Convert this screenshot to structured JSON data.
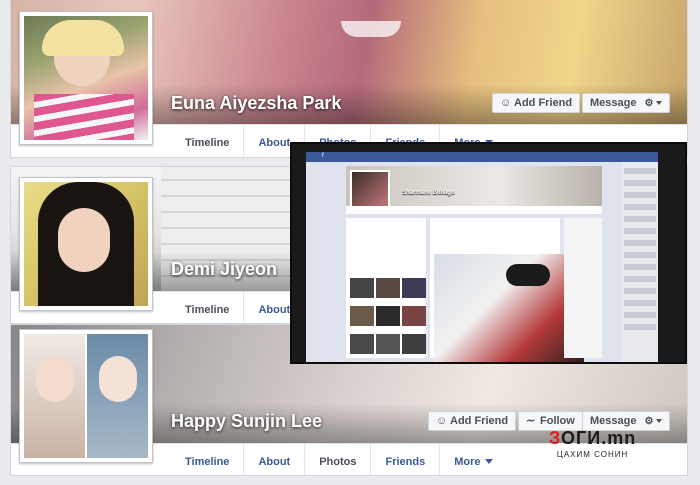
{
  "profiles": [
    {
      "name": "Euna Aiyezsha Park",
      "tabs": [
        "Timeline",
        "About",
        "Photos",
        "Friends",
        "More"
      ],
      "buttons": {
        "add_friend": "Add Friend",
        "message": "Message"
      }
    },
    {
      "name": "Demi Jiyeon",
      "tabs": [
        "Timeline",
        "About"
      ]
    },
    {
      "name": "Happy Sunjin Lee",
      "tabs": [
        "Timeline",
        "About",
        "Photos",
        "Friends",
        "More"
      ],
      "buttons": {
        "add_friend": "Add Friend",
        "follow": "Follow",
        "message": "Message"
      }
    }
  ],
  "screenshot": {
    "profile_name": "Sharmane Biolago"
  },
  "watermark": {
    "title_red": "З",
    "title_rest": "ОГИ.mn",
    "subtitle": "ЦАХИМ СОНИН"
  },
  "icons": {
    "add_friend": "add-friend-icon",
    "follow": "rss-follow-icon",
    "gear": "gear-icon",
    "dropdown": "caret-down-icon"
  },
  "colors": {
    "link": "#3b5998",
    "tab_active": "#4b4f56",
    "fb_blue": "#3b5998",
    "watermark_red": "#e21b22"
  }
}
